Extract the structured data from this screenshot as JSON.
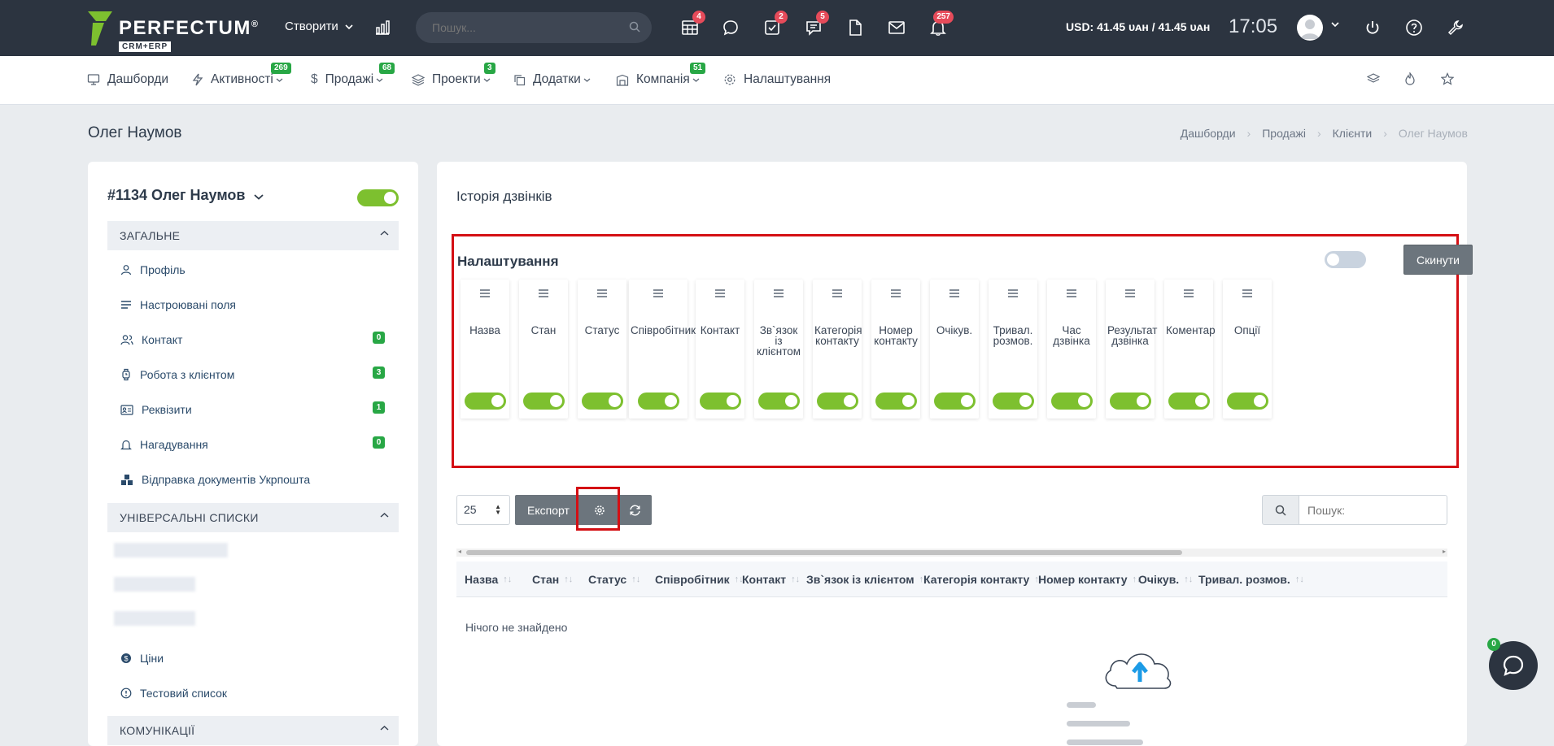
{
  "topbar": {
    "logo_name": "PERFECTUM",
    "logo_reg": "®",
    "logo_sub": "CRM+ERP",
    "create_label": "Створити",
    "search_placeholder": "Пошук...",
    "icons": [
      {
        "name": "tasks-board-icon",
        "badge": "4"
      },
      {
        "name": "chat-bubble-icon",
        "badge": ""
      },
      {
        "name": "checklist-icon",
        "badge": "2"
      },
      {
        "name": "comments-icon",
        "badge": "5"
      },
      {
        "name": "document-icon",
        "badge": ""
      },
      {
        "name": "mail-icon",
        "badge": ""
      },
      {
        "name": "bell-icon",
        "badge": "257"
      }
    ],
    "currency": "USD: 41.45 ᴜᴀʜ / 41.45 ᴜᴀʜ",
    "clock": "17:05"
  },
  "nav": {
    "items": [
      {
        "label": "Дашборди",
        "badge": ""
      },
      {
        "label": "Активності",
        "badge": "269"
      },
      {
        "label": "Продажі",
        "badge": "68"
      },
      {
        "label": "Проекти",
        "badge": "3"
      },
      {
        "label": "Додатки",
        "badge": ""
      },
      {
        "label": "Компанія",
        "badge": "51"
      },
      {
        "label": "Налаштування",
        "badge": ""
      }
    ]
  },
  "page": {
    "title": "Олег Наумов",
    "breadcrumb": [
      "Дашборди",
      "Продажі",
      "Клієнти",
      "Олег Наумов"
    ]
  },
  "left": {
    "client_head": "#1134 Олег Наумов",
    "client_active": true,
    "section_general": "ЗАГАЛЬНЕ",
    "menu": [
      {
        "label": "Профіль",
        "badge": ""
      },
      {
        "label": "Настроювані поля",
        "badge": ""
      },
      {
        "label": "Контакт",
        "badge": "0"
      },
      {
        "label": "Робота з клієнтом",
        "badge": "3"
      },
      {
        "label": "Реквізити",
        "badge": "1"
      },
      {
        "label": "Нагадування",
        "badge": "0"
      },
      {
        "label": "Відправка документів Укрпошта",
        "badge": ""
      }
    ],
    "section_universal": "УНІВЕРСАЛЬНІ СПИСКИ",
    "universal_menu": [
      {
        "label": "Ціни"
      },
      {
        "label": "Тестовий список"
      }
    ],
    "section_comm": "КОМУНІКАЦІЇ"
  },
  "main": {
    "title": "Історія дзвінків",
    "settings": {
      "title": "Налаштування",
      "reset_label": "Скинути",
      "reset_toggle_on": false,
      "columns": [
        {
          "label": "Назва",
          "on": true
        },
        {
          "label": "Стан",
          "on": true
        },
        {
          "label": "Статус",
          "on": true
        },
        {
          "label": "Співробітник",
          "on": true
        },
        {
          "label": "Контакт",
          "on": true
        },
        {
          "label": "Зв`язок із клієнтом",
          "on": true
        },
        {
          "label": "Категорія контакту",
          "on": true
        },
        {
          "label": "Номер контакту",
          "on": true
        },
        {
          "label": "Очікув.",
          "on": true
        },
        {
          "label": "Тривал. розмов.",
          "on": true
        },
        {
          "label": "Час дзвінка",
          "on": true
        },
        {
          "label": "Результат дзвінка",
          "on": true
        },
        {
          "label": "Коментар",
          "on": true
        },
        {
          "label": "Опції",
          "on": true
        }
      ]
    },
    "page_length": "25",
    "export_label": "Експорт",
    "search_placeholder": "Пошук:",
    "table_headers": [
      "Назва",
      "Стан",
      "Статус",
      "Співробітник",
      "Контакт",
      "Зв`язок із клієнтом",
      "Категорія контакту",
      "Номер контакту",
      "Очікув.",
      "Тривал. розмов."
    ],
    "empty_text": "Нічого не знайдено"
  },
  "chat": {
    "badge": "0"
  },
  "colors": {
    "accent_green": "#7dc02f",
    "topbar": "#2c3440",
    "highlight_red": "#d40f14",
    "badge_red": "#e64b5a",
    "badge_green": "#28a745"
  }
}
